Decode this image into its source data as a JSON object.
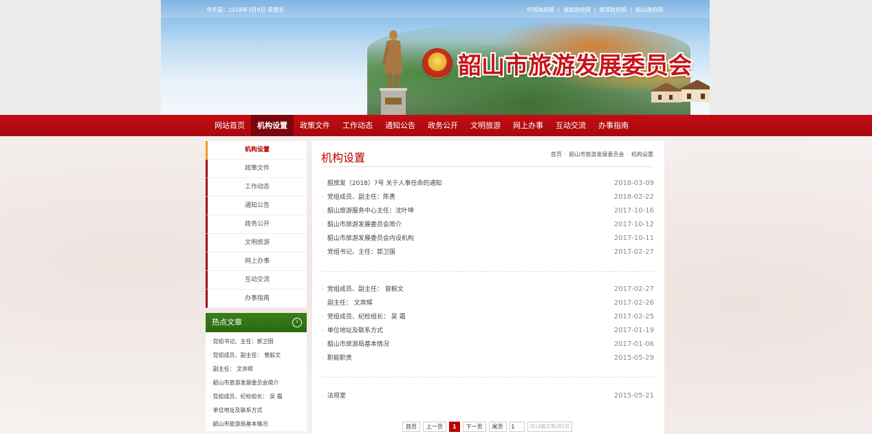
{
  "header": {
    "date_text": "今天是：2018年3月9日 星期五",
    "top_links": [
      "中国政府网",
      "湖南政府网",
      "湘潭政府网",
      "韶山政府网"
    ],
    "site_title": "韶山市旅游发展委员会"
  },
  "nav": {
    "items": [
      "网站首页",
      "机构设置",
      "政策文件",
      "工作动态",
      "通知公告",
      "政务公开",
      "文明旅游",
      "网上办事",
      "互动交流",
      "办事指南"
    ],
    "active": "机构设置"
  },
  "sidebar": {
    "items": [
      "机构设置",
      "政策文件",
      "工作动态",
      "通知公告",
      "政务公开",
      "文明旅游",
      "网上办事",
      "互动交流",
      "办事指南"
    ],
    "hot_title": "热点文章",
    "hot_items": [
      "党组书记、主任：郭卫国",
      "党组成员、副主任： 曾毅文",
      "副主任： 文奔辉",
      "韶山市旅游发展委员会简介",
      "党组成员、纪检组长： 吴 霜",
      "单位地址及联系方式",
      "韶山市旅游局基本情况"
    ]
  },
  "main": {
    "title": "机构设置",
    "breadcrumb": [
      "首页",
      "韶山市旅游发展委员会",
      "机构设置"
    ],
    "groups": [
      [
        {
          "title": "韶旅发〔2018〕7号 关于人事任命的通知",
          "date": "2018-03-09"
        },
        {
          "title": "党组成员、副主任：陈勇",
          "date": "2018-02-22"
        },
        {
          "title": "韶山旅游服务中心主任：沈叶坤",
          "date": "2017-10-16"
        },
        {
          "title": "韶山市旅游发展委员会简介",
          "date": "2017-10-12"
        },
        {
          "title": "韶山市旅游发展委员会内设机构",
          "date": "2017-10-11"
        },
        {
          "title": "党组书记、主任：郭卫国",
          "date": "2017-02-27"
        }
      ],
      [
        {
          "title": "党组成员、副主任： 曾毅文",
          "date": "2017-02-27"
        },
        {
          "title": "副主任： 文奔辉",
          "date": "2017-02-26"
        },
        {
          "title": "党组成员、纪检组长： 吴 霜",
          "date": "2017-02-25"
        },
        {
          "title": "单位地址及联系方式",
          "date": "2017-01-19"
        },
        {
          "title": "韶山市旅游局基本情况",
          "date": "2017-01-06"
        },
        {
          "title": "职能职责",
          "date": "2015-05-29"
        }
      ],
      [
        {
          "title": "法规室",
          "date": "2015-05-21"
        }
      ]
    ]
  },
  "pager": {
    "first": "首页",
    "prev": "上一页",
    "current": "1",
    "next": "下一页",
    "last": "尾页",
    "page_input": "1",
    "info": "共13篇文章/共1页"
  },
  "colors": {
    "brand_red": "#b00000",
    "nav_red": "#b8080f",
    "hot_green": "#2f7215",
    "active_accent": "#f29a1f"
  }
}
